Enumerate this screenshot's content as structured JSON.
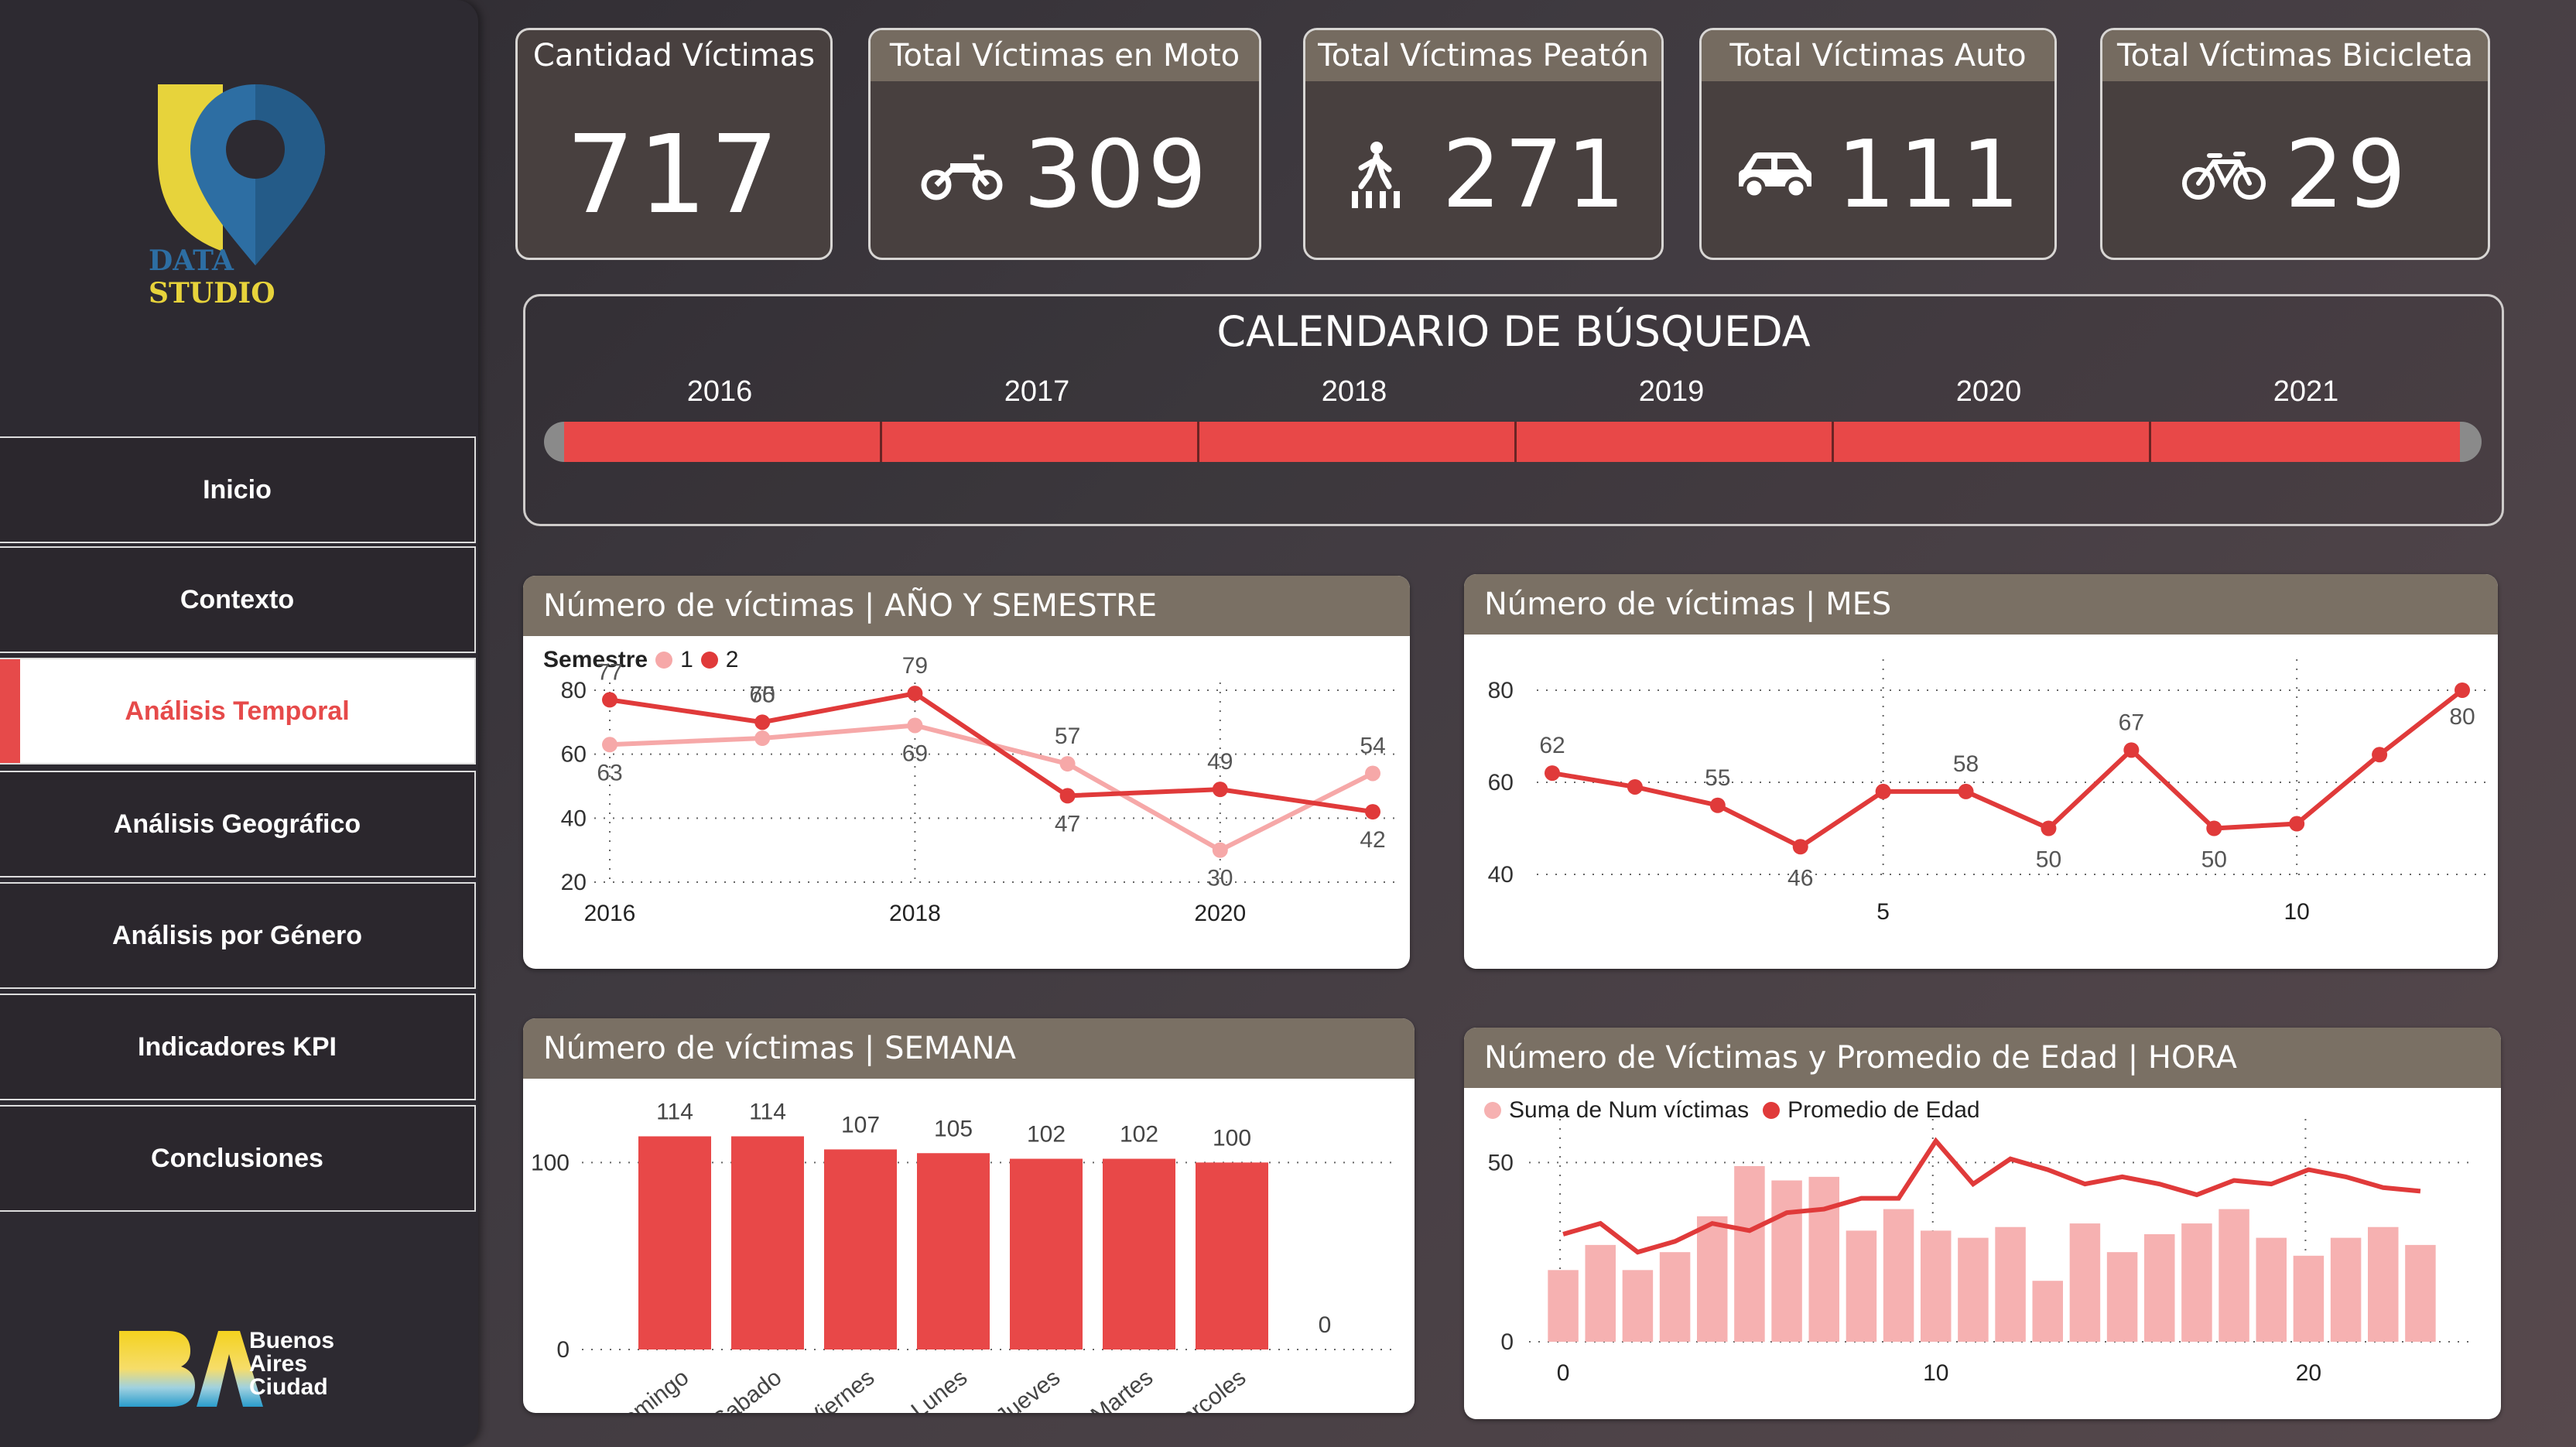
{
  "brand": {
    "logo_text_left": "DATA",
    "logo_text_right": "STUDIO",
    "city_logo_lines": [
      "Buenos",
      "Aires",
      "Ciudad"
    ],
    "colors": {
      "accent": "#e84848",
      "accent_light": "#f6b1b1",
      "panel_header": "#7a7064",
      "yellow": "#e7d33b",
      "blue": "#2d6ea3"
    }
  },
  "nav": {
    "items": [
      {
        "label": "Inicio"
      },
      {
        "label": "Contexto"
      },
      {
        "label": "Análisis Temporal",
        "active": true
      },
      {
        "label": "Análisis Geográfico"
      },
      {
        "label": "Análisis por Género"
      },
      {
        "label": "Indicadores KPI"
      },
      {
        "label": "Conclusiones"
      }
    ]
  },
  "kpis": [
    {
      "title": "Cantidad Víctimas",
      "value": "717",
      "icon": "none"
    },
    {
      "title": "Total Víctimas en Moto",
      "value": "309",
      "icon": "motorcycle-icon"
    },
    {
      "title": "Total Víctimas Peatón",
      "value": "271",
      "icon": "pedestrian-icon"
    },
    {
      "title": "Total Víctimas Auto",
      "value": "111",
      "icon": "car-icon"
    },
    {
      "title": "Total Víctimas Bicicleta",
      "value": "29",
      "icon": "bicycle-icon"
    }
  ],
  "calendar": {
    "title": "CALENDARIO DE BÚSQUEDA",
    "years": [
      "2016",
      "2017",
      "2018",
      "2019",
      "2020",
      "2021"
    ]
  },
  "charts": {
    "semestre": {
      "title": "Número de víctimas | AÑO Y SEMESTRE",
      "legend_title": "Semestre",
      "legend": [
        "1",
        "2"
      ]
    },
    "mes": {
      "title": "Número de víctimas | MES"
    },
    "semana": {
      "title": "Número de víctimas | SEMANA"
    },
    "hora": {
      "title": "Número de Víctimas y Promedio de Edad | HORA",
      "legend": [
        "Suma de Num víctimas",
        "Promedio de Edad"
      ]
    }
  },
  "chart_data": [
    {
      "type": "line",
      "title": "Número de víctimas | AÑO Y SEMESTRE",
      "x": [
        2016,
        2017,
        2018,
        2019,
        2020,
        2021
      ],
      "xticks": [
        "2016",
        "2018",
        "2020"
      ],
      "ylim": [
        20,
        80
      ],
      "yticks": [
        20,
        40,
        60,
        80
      ],
      "series": [
        {
          "name": "1",
          "values": [
            63,
            65,
            69,
            57,
            30,
            54
          ],
          "labels": [
            "63",
            "",
            "69",
            "57",
            "30",
            "54"
          ],
          "color": "#f6a8a8"
        },
        {
          "name": "2",
          "values": [
            77,
            70,
            79,
            47,
            49,
            42
          ],
          "labels": [
            "77",
            "70",
            "79",
            "47",
            "49",
            "42"
          ],
          "color": "#e03a3a"
        }
      ],
      "extra_labels": [
        {
          "x": 2017,
          "text": "65",
          "series": "1"
        }
      ]
    },
    {
      "type": "line",
      "title": "Número de víctimas | MES",
      "x": [
        1,
        2,
        3,
        4,
        5,
        6,
        7,
        8,
        9,
        10,
        11,
        12
      ],
      "values": [
        62,
        59,
        55,
        46,
        58,
        58,
        50,
        67,
        50,
        51,
        66,
        80
      ],
      "labels": [
        "62",
        "",
        "55",
        "46",
        "",
        "58",
        "50",
        "67",
        "50",
        "",
        "",
        "80"
      ],
      "xticks": [
        5,
        10
      ],
      "ylim": [
        40,
        80
      ],
      "yticks": [
        40,
        60,
        80
      ]
    },
    {
      "type": "bar",
      "title": "Número de víctimas | SEMANA",
      "categories": [
        "Domingo",
        "Sabado",
        "Viernes",
        "Lunes",
        "Jueves",
        "Martes",
        "Miercoles",
        ""
      ],
      "values": [
        114,
        114,
        107,
        105,
        102,
        102,
        100,
        0
      ],
      "ylim": [
        0,
        120
      ],
      "yticks": [
        0,
        100
      ]
    },
    {
      "type": "bar",
      "title": "Número de Víctimas y Promedio de Edad | HORA",
      "x": [
        0,
        1,
        2,
        3,
        4,
        5,
        6,
        7,
        8,
        9,
        10,
        11,
        12,
        13,
        14,
        15,
        16,
        17,
        18,
        19,
        20,
        21,
        22,
        23
      ],
      "xticks": [
        0,
        10,
        20
      ],
      "ylim": [
        0,
        60
      ],
      "yticks": [
        0,
        50
      ],
      "series": [
        {
          "name": "Suma de Num víctimas",
          "type": "bar",
          "values": [
            20,
            27,
            20,
            25,
            35,
            49,
            45,
            46,
            31,
            37,
            31,
            29,
            32,
            17,
            33,
            25,
            30,
            33,
            37,
            29,
            24,
            29,
            32,
            27
          ]
        },
        {
          "name": "Promedio de Edad",
          "type": "line",
          "values": [
            30,
            33,
            25,
            28,
            33,
            31,
            36,
            37,
            40,
            40,
            56,
            44,
            51,
            48,
            44,
            46,
            44,
            41,
            45,
            44,
            48,
            46,
            43,
            42
          ]
        }
      ]
    }
  ]
}
